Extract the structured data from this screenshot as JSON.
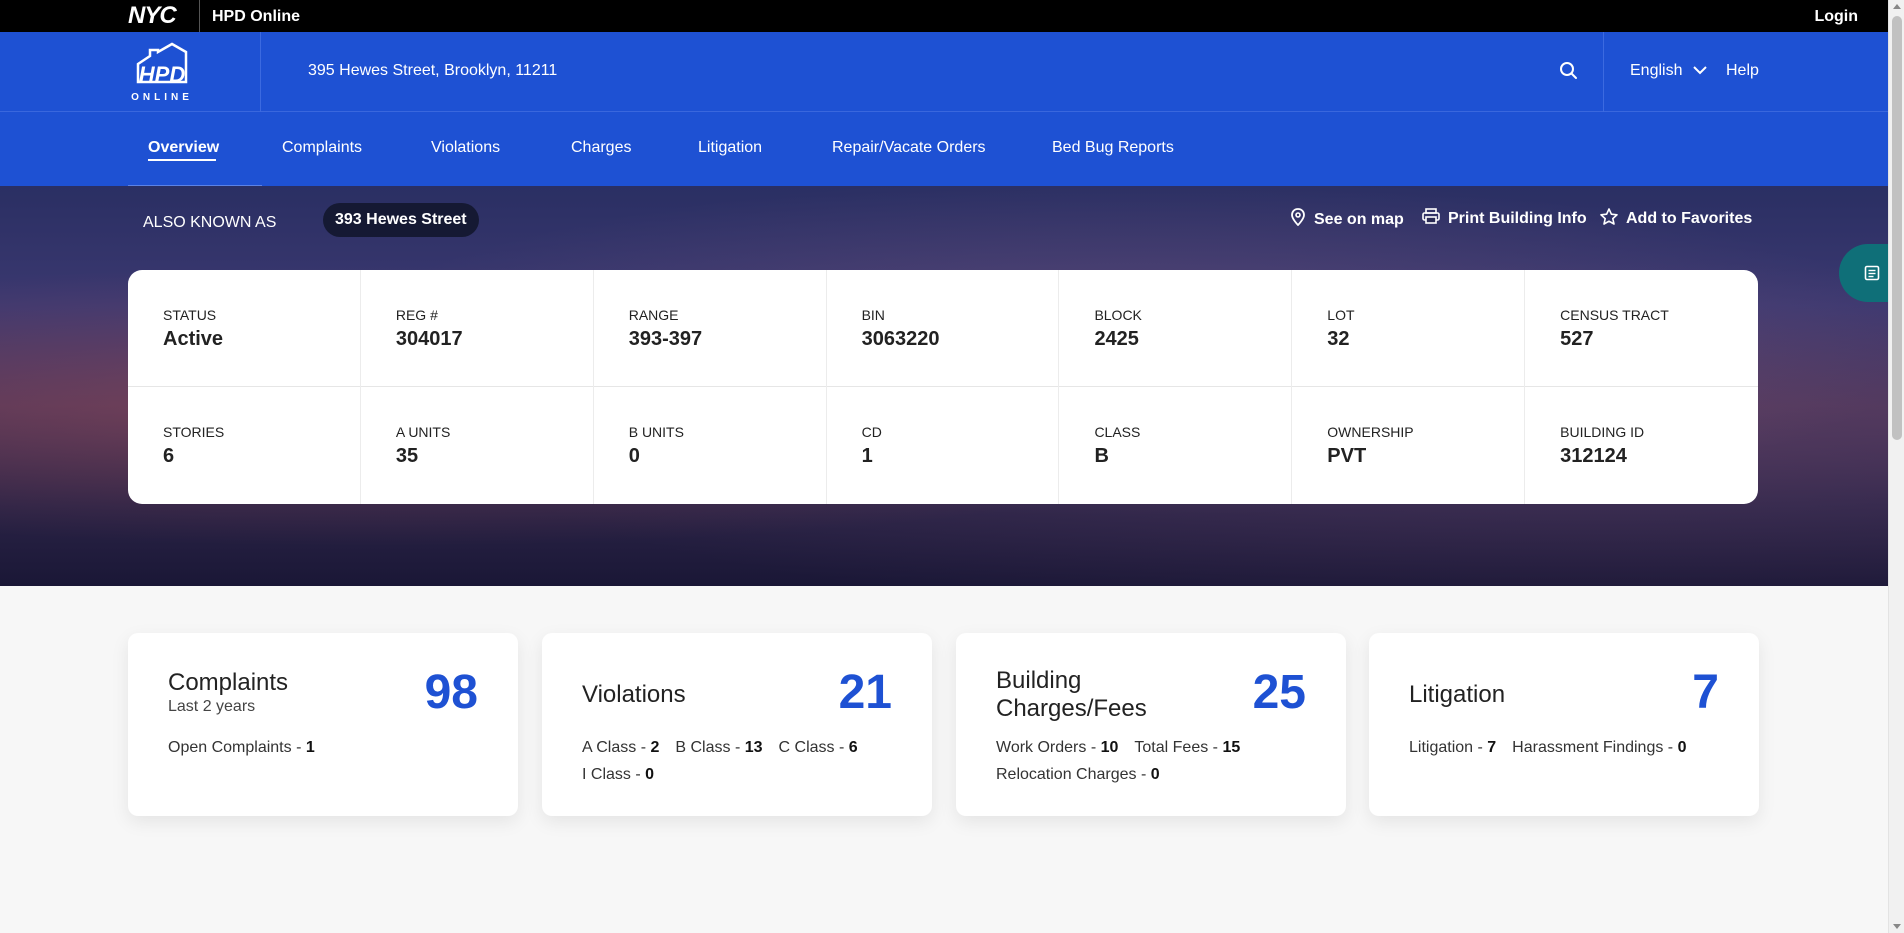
{
  "topbar": {
    "nyc_logo": "NYC",
    "app_name": "HPD Online",
    "login_label": "Login"
  },
  "header": {
    "logo_text_top": "HPD",
    "logo_text_bottom": "ONLINE",
    "address": "395 Hewes Street, Brooklyn, 11211",
    "language": "English",
    "help_label": "Help"
  },
  "nav": {
    "tabs": [
      {
        "label": "Overview",
        "active": true
      },
      {
        "label": "Complaints"
      },
      {
        "label": "Violations"
      },
      {
        "label": "Charges"
      },
      {
        "label": "Litigation"
      },
      {
        "label": "Repair/Vacate Orders"
      },
      {
        "label": "Bed Bug Reports"
      }
    ]
  },
  "hero": {
    "aka_label": "ALSO KNOWN AS",
    "aka_value": "393 Hewes Street",
    "actions": {
      "map": "See on map",
      "print": "Print Building Info",
      "favorites": "Add to Favorites"
    }
  },
  "building": {
    "row1": [
      {
        "label": "STATUS",
        "value": "Active"
      },
      {
        "label": "REG #",
        "value": "304017"
      },
      {
        "label": "RANGE",
        "value": "393-397"
      },
      {
        "label": "BIN",
        "value": "3063220"
      },
      {
        "label": "BLOCK",
        "value": "2425"
      },
      {
        "label": "LOT",
        "value": "32"
      },
      {
        "label": "CENSUS TRACT",
        "value": "527"
      }
    ],
    "row2": [
      {
        "label": "STORIES",
        "value": "6"
      },
      {
        "label": "A UNITS",
        "value": "35"
      },
      {
        "label": "B UNITS",
        "value": "0"
      },
      {
        "label": "CD",
        "value": "1"
      },
      {
        "label": "CLASS",
        "value": "B"
      },
      {
        "label": "OWNERSHIP",
        "value": "PVT"
      },
      {
        "label": "BUILDING ID",
        "value": "312124"
      }
    ]
  },
  "summary": {
    "complaints": {
      "title": "Complaints",
      "subtitle": "Last 2 years",
      "count": "98",
      "open_label": "Open Complaints - ",
      "open_value": "1"
    },
    "violations": {
      "title": "Violations",
      "count": "21",
      "a_label": "A Class - ",
      "a_value": "2",
      "b_label": "B Class - ",
      "b_value": "13",
      "c_label": "C Class - ",
      "c_value": "6",
      "i_label": "I Class - ",
      "i_value": "0"
    },
    "charges": {
      "title_line1": "Building",
      "title_line2": "Charges/Fees",
      "count": "25",
      "wo_label": "Work Orders - ",
      "wo_value": "10",
      "tf_label": "Total Fees - ",
      "tf_value": "15",
      "rc_label": "Relocation Charges - ",
      "rc_value": "0"
    },
    "litigation": {
      "title": "Litigation",
      "count": "7",
      "lit_label": "Litigation - ",
      "lit_value": "7",
      "hf_label": "Harassment Findings - ",
      "hf_value": "0"
    }
  },
  "colors": {
    "brand_blue": "#1e51d3",
    "fab_teal": "#0f6f78"
  }
}
